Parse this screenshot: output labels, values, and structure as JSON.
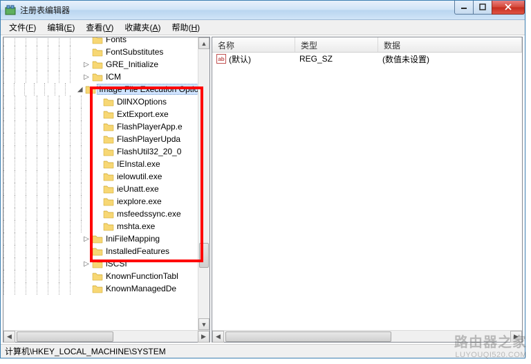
{
  "window": {
    "title": "注册表编辑器"
  },
  "menu": {
    "file": {
      "label": "文件",
      "accel": "F"
    },
    "edit": {
      "label": "编辑",
      "accel": "E"
    },
    "view": {
      "label": "查看",
      "accel": "V"
    },
    "fav": {
      "label": "收藏夹",
      "accel": "A"
    },
    "help": {
      "label": "帮助",
      "accel": "H"
    }
  },
  "tree": {
    "items": [
      {
        "label": "Fonts",
        "expander": ""
      },
      {
        "label": "FontSubstitutes",
        "expander": ""
      },
      {
        "label": "GRE_Initialize",
        "expander": "▷"
      },
      {
        "label": "ICM",
        "expander": "▷"
      },
      {
        "label": "Image File Execution Options",
        "expander": "◢",
        "selected": true
      },
      {
        "label": "DllNXOptions",
        "expander": "",
        "child": true
      },
      {
        "label": "ExtExport.exe",
        "expander": "",
        "child": true
      },
      {
        "label": "FlashPlayerApp.e",
        "expander": "",
        "child": true
      },
      {
        "label": "FlashPlayerUpda",
        "expander": "",
        "child": true
      },
      {
        "label": "FlashUtil32_20_0",
        "expander": "",
        "child": true
      },
      {
        "label": "IEInstal.exe",
        "expander": "",
        "child": true
      },
      {
        "label": "ielowutil.exe",
        "expander": "",
        "child": true
      },
      {
        "label": "ieUnatt.exe",
        "expander": "",
        "child": true
      },
      {
        "label": "iexplore.exe",
        "expander": "",
        "child": true
      },
      {
        "label": "msfeedssync.exe",
        "expander": "",
        "child": true
      },
      {
        "label": "mshta.exe",
        "expander": "",
        "child": true
      },
      {
        "label": "IniFileMapping",
        "expander": "▷"
      },
      {
        "label": "InstalledFeatures",
        "expander": ""
      },
      {
        "label": "iSCSI",
        "expander": "▷"
      },
      {
        "label": "KnownFunctionTabl",
        "expander": ""
      },
      {
        "label": "KnownManagedDe",
        "expander": ""
      }
    ]
  },
  "list": {
    "cols": {
      "name": "名称",
      "type": "类型",
      "data": "数据"
    },
    "row": {
      "name": "(默认)",
      "type": "REG_SZ",
      "data": "(数值未设置)",
      "icon": "ab"
    }
  },
  "status": {
    "path": "计算机\\HKEY_LOCAL_MACHINE\\SYSTEM"
  },
  "watermark": {
    "big": "路由器之家",
    "small": "LUYOUQI520.COM"
  }
}
